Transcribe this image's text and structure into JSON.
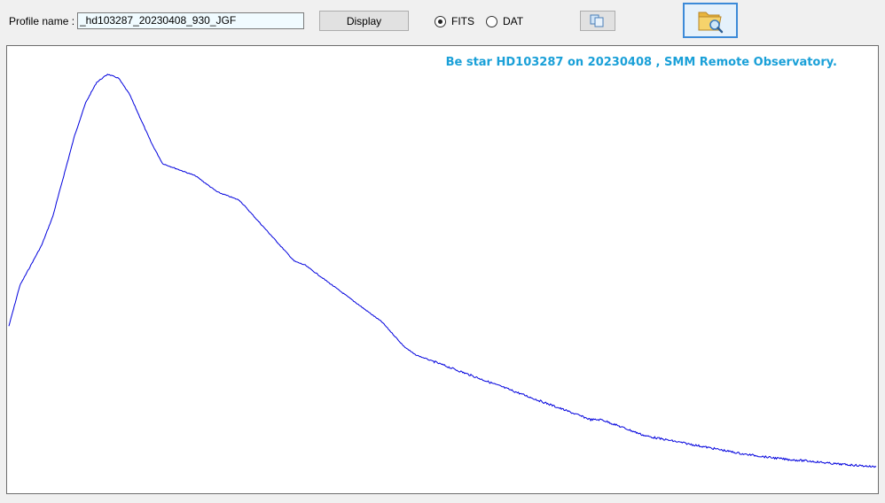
{
  "toolbar": {
    "profile_label": "Profile name :",
    "profile_value": "_hd103287_20230408_930_JGF",
    "display_label": "Display",
    "format_options": [
      {
        "label": "FITS",
        "selected": true
      },
      {
        "label": "DAT",
        "selected": false
      }
    ],
    "copy_icon": "copy-icon",
    "open_icon": "folder-search-icon"
  },
  "colors": {
    "spectrum": "#0000dd",
    "title": "#1aa0d8",
    "accent": "#3c8ad8"
  },
  "chart_data": {
    "type": "line",
    "title": "Be star HD103287 on 20230408 , SMM Remote Observatory.",
    "xlabel": "",
    "ylabel": "",
    "grid": false,
    "legend": "none",
    "series": [
      {
        "values": [
          0.35,
          0.45,
          0.5,
          0.55,
          0.62,
          0.72,
          0.82,
          0.9,
          0.95,
          0.97,
          0.96,
          0.92,
          0.86,
          0.8,
          0.75,
          0.74,
          0.73,
          0.72,
          0.7,
          0.68,
          0.67,
          0.66,
          0.63,
          0.6,
          0.57,
          0.54,
          0.51,
          0.5,
          0.48,
          0.46,
          0.44,
          0.42,
          0.4,
          0.38,
          0.36,
          0.33,
          0.3,
          0.28,
          0.27,
          0.26,
          0.25,
          0.24,
          0.23,
          0.22,
          0.21,
          0.2,
          0.19,
          0.18,
          0.17,
          0.16,
          0.15,
          0.14,
          0.13,
          0.12,
          0.12,
          0.11,
          0.1,
          0.09,
          0.08,
          0.075,
          0.07,
          0.065,
          0.06,
          0.055,
          0.05,
          0.045,
          0.04,
          0.035,
          0.032,
          0.028,
          0.025,
          0.022,
          0.02,
          0.018,
          0.015,
          0.012,
          0.01,
          0.008,
          0.006,
          0.004
        ]
      }
    ]
  }
}
